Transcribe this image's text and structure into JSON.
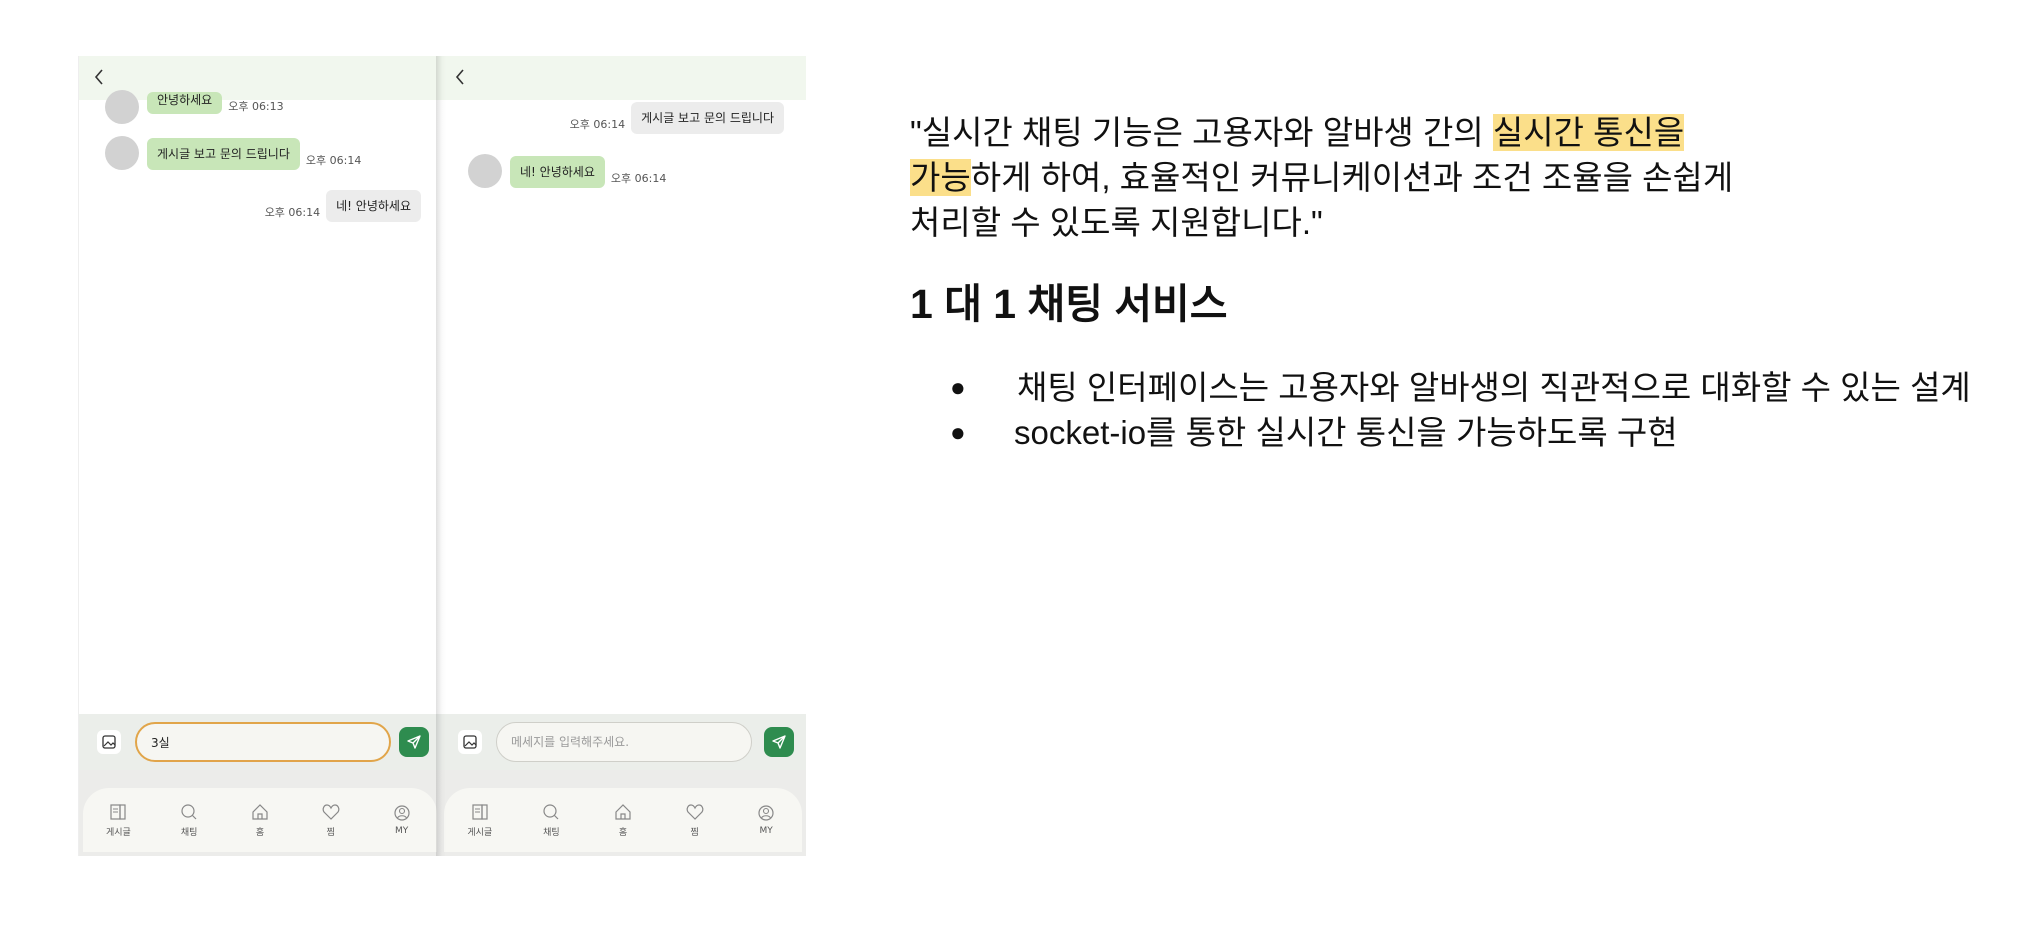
{
  "phones": [
    {
      "id": "left",
      "messages": [
        {
          "side": "left",
          "text": "안녕하세요",
          "time": "오후 06:13",
          "partial": true
        },
        {
          "side": "left",
          "text": "게시글 보고 문의 드립니다",
          "time": "오후 06:14"
        },
        {
          "side": "right",
          "text": "네! 안녕하세요",
          "time": "오후 06:14"
        }
      ],
      "input": {
        "value": "3실",
        "placeholder": ""
      }
    },
    {
      "id": "right",
      "messages": [
        {
          "side": "right",
          "text": "게시글 보고 문의 드립니다",
          "time": "오후 06:14"
        },
        {
          "side": "left",
          "text": "네! 안녕하세요",
          "time": "오후 06:14"
        }
      ],
      "input": {
        "value": "",
        "placeholder": "메세지를 입력해주세요."
      }
    }
  ],
  "nav": [
    {
      "label": "게시글",
      "icon": "board-icon"
    },
    {
      "label": "채팅",
      "icon": "chat-icon"
    },
    {
      "label": "홈",
      "icon": "home-icon"
    },
    {
      "label": "찜",
      "icon": "heart-icon"
    },
    {
      "label": "MY",
      "icon": "profile-icon"
    }
  ],
  "slide": {
    "quote_part1": "\"실시간 채팅 기능은 고용자와 알바생 간의 ",
    "quote_highlight1": "실시간 통신을",
    "quote_highlight2": "가능",
    "quote_part2": "하게 하여, 효율적인 커뮤니케이션과 조건 조율을 손쉽게",
    "quote_part3": "처리할 수 있도록 지원합니다.\"",
    "heading": "1 대 1 채팅 서비스",
    "bullets": [
      "채팅 인터페이스는 고용자와 알바생의 직관적으로 대화할 수 있는 설계",
      "socket-io를 통한 실시간 통신을 가능하도록 구현"
    ]
  },
  "colors": {
    "accent_green": "#2e8c4f",
    "bubble_green": "#c8e6b8",
    "highlight": "#fbdf8a",
    "input_focus": "#e1a54a"
  }
}
